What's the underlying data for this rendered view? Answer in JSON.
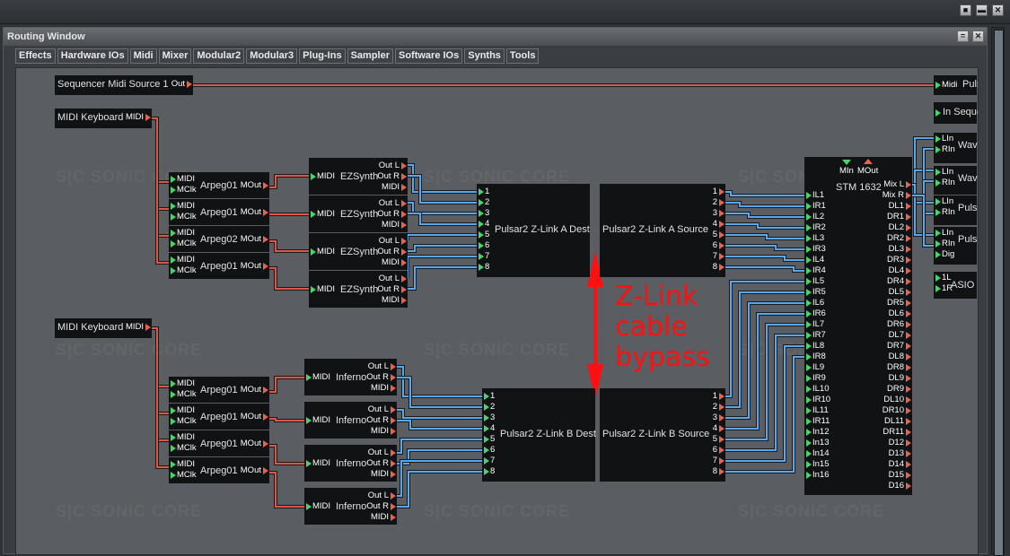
{
  "app": {
    "top_buttons": [
      "restore-icon",
      "minimize-icon",
      "close-icon"
    ]
  },
  "window": {
    "title": "Routing Window",
    "buttons": [
      "minimize-icon",
      "close-icon"
    ],
    "tabs": [
      "Effects",
      "Hardware IOs",
      "Midi",
      "Mixer",
      "Modular2",
      "Modular3",
      "Plug-Ins",
      "Sampler",
      "Software IOs",
      "Synths",
      "Tools"
    ]
  },
  "watermark": "S|C  SONIC CORE",
  "annotation": {
    "lines": [
      "Z-Link",
      "cable",
      "bypass"
    ],
    "color": "#ff1010"
  },
  "colors": {
    "midi_wire": "#e0574a",
    "audio_wire": "#58a8ee",
    "in_pin": "#4dd26a",
    "out_pin": "#e8634e",
    "canvas": "#5a5d61"
  },
  "modules": {
    "seq_source": {
      "name": "Sequencer Midi Source 1",
      "port": "Out"
    },
    "midi_pulsar": {
      "name": "Midi Puls",
      "port": "Midi"
    },
    "in_seq": {
      "name": "In Seque"
    },
    "kb1": {
      "name": "MIDI Keyboard",
      "port": "MIDI"
    },
    "kb2": {
      "name": "MIDI Keyboard",
      "port": "MIDI"
    },
    "arp_ports": {
      "in1": "MIDI",
      "in2": "MClk",
      "out": "MOut"
    },
    "arps_top": [
      "Arpeg01",
      "Arpeg01",
      "Arpeg02",
      "Arpeg01"
    ],
    "arps_bottom": [
      "Arpeg01",
      "Arpeg01",
      "Arpeg01",
      "Arpeg01"
    ],
    "synth_ports": {
      "in": "MIDI",
      "outL": "Out L",
      "outR": "Out R",
      "midi": "MIDI"
    },
    "synths_top": [
      "EZSynth",
      "EZSynth",
      "EZSynth",
      "EZSynth"
    ],
    "synths_bottom": [
      "Inferno",
      "Inferno",
      "Inferno",
      "Inferno"
    ],
    "zlink_a_dest": "Pulsar2 Z-Link A Dest",
    "zlink_a_source": "Pulsar2 Z-Link A Source",
    "zlink_b_dest": "Pulsar2 Z-Link B Dest",
    "zlink_b_source": "Pulsar2 Z-Link B Source",
    "zlink_ports": [
      "1",
      "2",
      "3",
      "4",
      "5",
      "6",
      "7",
      "8"
    ],
    "stm": {
      "name": "STM 1632",
      "top_ports": [
        "MIn",
        "MOut"
      ],
      "inputs": [
        "IL1",
        "IR1",
        "IL2",
        "IR2",
        "IL3",
        "IR3",
        "IL4",
        "IR4",
        "IL5",
        "IR5",
        "IL6",
        "IR6",
        "IL7",
        "IR7",
        "IL8",
        "IR8",
        "IL9",
        "IR9",
        "IL10",
        "IR10",
        "IL11",
        "IR11",
        "In12",
        "In13",
        "In14",
        "In15",
        "In16"
      ],
      "outputs": [
        "Mix L",
        "Mix R",
        "DL1",
        "DR1",
        "DL2",
        "DR2",
        "DL3",
        "DR3",
        "DL4",
        "DR4",
        "DL5",
        "DR5",
        "DL6",
        "DR6",
        "DL7",
        "DR7",
        "DL8",
        "DR8",
        "DL9",
        "DR9",
        "DL10",
        "DR10",
        "DL11",
        "DR11",
        "D12",
        "D13",
        "D14",
        "D15",
        "D16"
      ]
    },
    "right_modules": [
      {
        "name": "Wav",
        "ports": [
          "LIn",
          "RIn"
        ]
      },
      {
        "name": "Wav",
        "ports": [
          "LIn",
          "RIn"
        ]
      },
      {
        "name": "Puls",
        "ports": [
          "LIn",
          "RIn"
        ]
      },
      {
        "name": "Puls",
        "ports": [
          "LIn",
          "RIn",
          "Dig"
        ]
      },
      {
        "name": "ASIO",
        "ports": [
          "1L",
          "1R"
        ]
      }
    ]
  }
}
